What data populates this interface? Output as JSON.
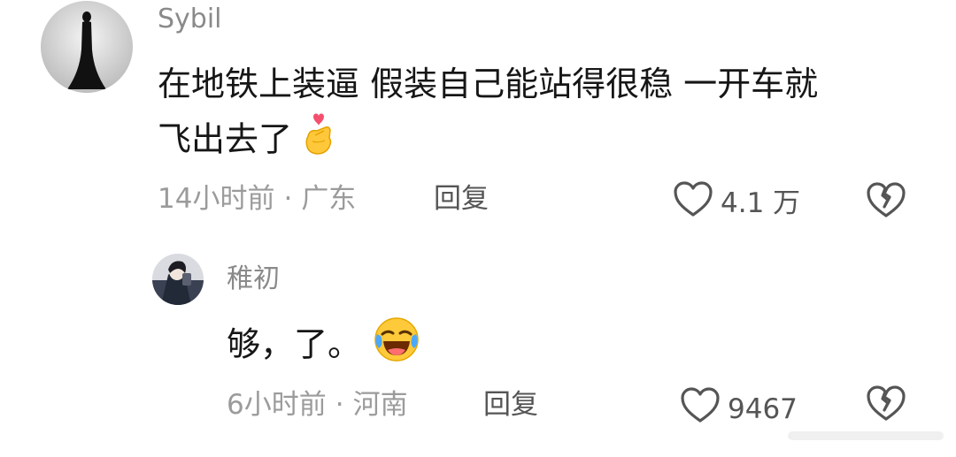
{
  "comments": [
    {
      "username": "Sybil",
      "text_line1": "在地铁上装逼 假装自己能站得很稳 一开车就",
      "text_line2": "飞出去了",
      "emoji": "heart-hands-emoji",
      "time": "14小时前",
      "separator": "·",
      "location": "广东",
      "reply_label": "回复",
      "likes": "4.1 万"
    },
    {
      "username": "稚初",
      "text": "够，了。",
      "emoji": "laughing-crying-emoji",
      "time": "6小时前",
      "separator": "·",
      "location": "河南",
      "reply_label": "回复",
      "likes": "9467"
    }
  ],
  "colors": {
    "meta_gray": "#9b9b9b",
    "text": "#161616",
    "icon_gray": "#555555"
  }
}
